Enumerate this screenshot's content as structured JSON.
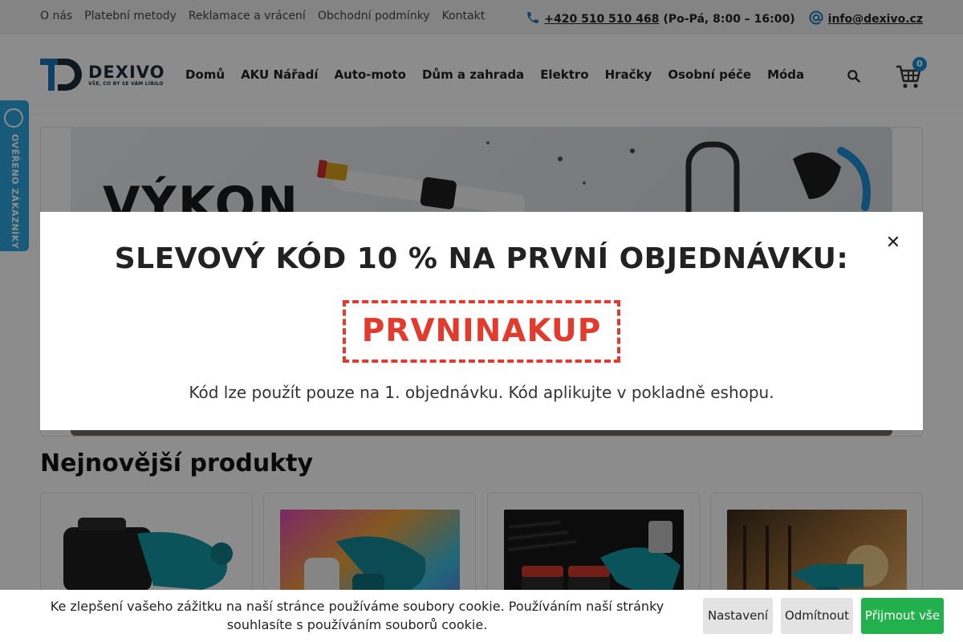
{
  "topbar": {
    "links": [
      "O nás",
      "Platební metody",
      "Reklamace a vrácení",
      "Obchodní podmínky",
      "Kontakt"
    ],
    "phone": "+420 510 510 468",
    "hours": "(Po-Pá, 8:00 – 16:00)",
    "email": "info@dexivo.cz",
    "phone_icon": "phone-icon",
    "email_icon": "at-icon"
  },
  "header": {
    "logo_name": "DEXIVO",
    "logo_tagline": "VŠE, CO BY SE VÁM LÍBILO",
    "nav": [
      "Domů",
      "AKU Nářadí",
      "Auto-moto",
      "Dům a zahrada",
      "Elektro",
      "Hračky",
      "Osobní péče",
      "Móda"
    ],
    "cart_count": "0",
    "search_icon": "search-icon",
    "cart_icon": "cart-icon"
  },
  "hero": {
    "title": "VÝKON"
  },
  "verified_badge": {
    "text": "OVĚŘENO ZÁKAZNÍKY"
  },
  "section": {
    "title": "Nejnovější produkty"
  },
  "modal": {
    "title": "SLEVOVÝ KÓD 10 % NA PRVNÍ OBJEDNÁVKU:",
    "code": "PRVNINAKUP",
    "note": "Kód lze použít pouze na 1. objednávku. Kód aplikujte v pokladně eshopu.",
    "close": "✕"
  },
  "cookie": {
    "text": "Ke zlepšení vašeho zážitku na naší stránce používáme soubory cookie. Používáním naší stránky souhlasíte s používáním souborů cookie.",
    "settings": "Nastavení",
    "reject": "Odmítnout",
    "accept": "Přijmout vše"
  },
  "colors": {
    "accent_blue": "#1b75bb",
    "code_red": "#e23b2e",
    "accept_green": "#22b14c"
  }
}
